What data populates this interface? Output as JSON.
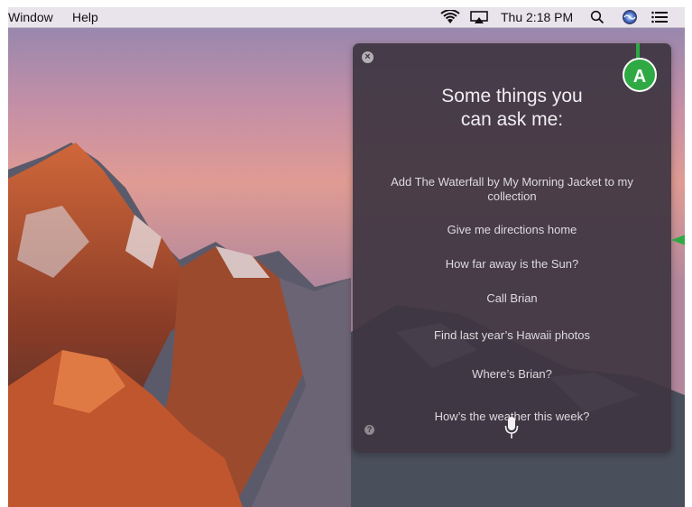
{
  "menubar": {
    "window_label": "Window",
    "help_label": "Help",
    "clock": "Thu 2:18 PM"
  },
  "icons": {
    "wifi": "wifi-icon",
    "airplay": "airplay-icon",
    "spotlight": "search-icon",
    "siri": "siri-icon",
    "notification_center": "list-icon"
  },
  "siri_panel": {
    "title_line1": "Some things you",
    "title_line2": "can ask me:",
    "suggestions": [
      "Add The Waterfall by My Morning Jacket to my collection",
      "Give me directions home",
      "How far away is the Sun?",
      "Call Brian",
      "Find last year’s Hawaii photos",
      "Where’s Brian?",
      "How’s the weather this week?"
    ]
  },
  "callout": {
    "label": "A",
    "color": "#2fa944"
  }
}
